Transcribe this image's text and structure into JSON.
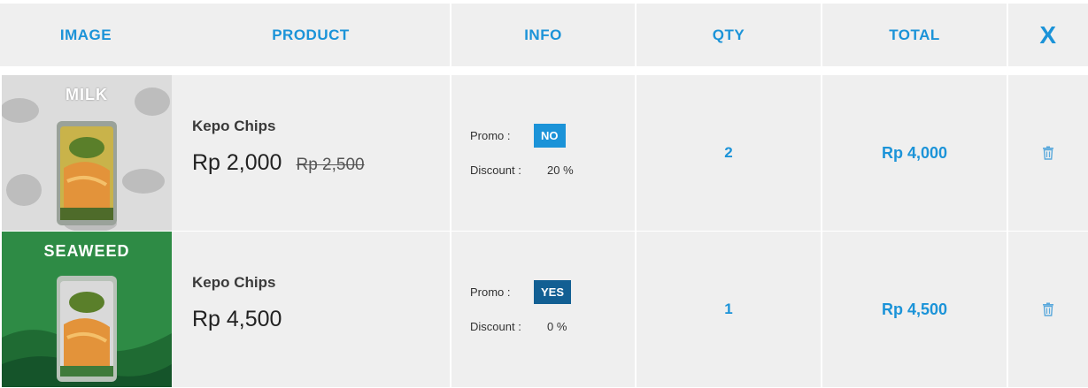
{
  "columns": {
    "image": "IMAGE",
    "product": "PRODUCT",
    "info": "INFO",
    "qty": "QTY",
    "total": "TOTAL",
    "remove": "X"
  },
  "items": [
    {
      "image_text": "MILK",
      "name": "Kepo Chips",
      "price": "Rp 2,000",
      "old_price": "Rp 2,500",
      "promo_label": "Promo :",
      "promo": "NO",
      "discount_label": "Discount :",
      "discount": "20 %",
      "qty": "2",
      "total": "Rp 4,000",
      "remove_icon": "trash-icon"
    },
    {
      "image_text": "SEAWEED",
      "name": "Kepo Chips",
      "price": "Rp 4,500",
      "old_price": "",
      "promo_label": "Promo :",
      "promo": "YES",
      "discount_label": "Discount :",
      "discount": "0 %",
      "qty": "1",
      "total": "Rp 4,500",
      "remove_icon": "trash-icon"
    }
  ],
  "colors": {
    "accent": "#1b93d8",
    "promo_no": "#1b93d8",
    "promo_yes": "#125f93",
    "cell_bg": "#efefef"
  }
}
